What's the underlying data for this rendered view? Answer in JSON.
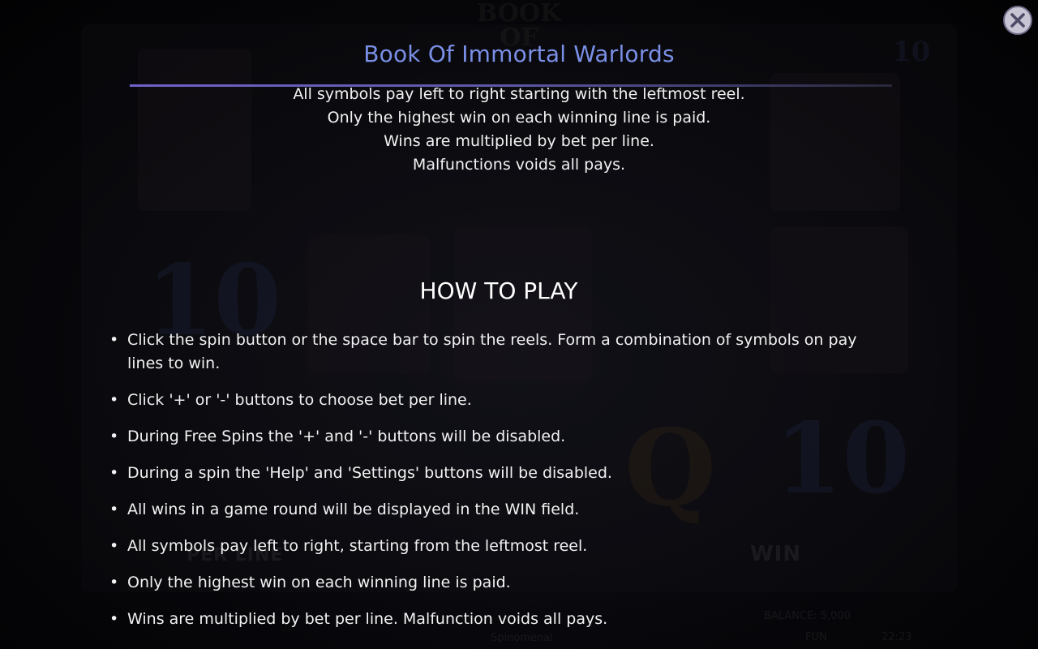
{
  "dialog": {
    "title": "Book Of Immortal Warlords",
    "intro_lines": [
      "All symbols pay left to right starting with the leftmost reel.",
      "Only the highest win on each winning line is paid.",
      "Wins are multiplied by bet per line.",
      "Malfunctions voids all pays."
    ],
    "section_heading": "HOW TO PLAY",
    "bullet_char": "•",
    "rules": [
      "Click the spin button or the space bar to spin the reels. Form a combination of symbols on pay lines to win.",
      "Click '+' or '-' buttons to choose bet per line.",
      "During Free Spins the '+' and '-' buttons will be disabled.",
      "During a spin the 'Help' and 'Settings' buttons will be disabled.",
      "All wins in a game round will be displayed in the WIN field.",
      "All symbols pay left to right, starting from the leftmost reel.",
      "Only the highest win on each winning line is paid.",
      "Wins are multiplied by bet per line. Malfunction voids all pays."
    ],
    "close_icon": "close-icon"
  },
  "background": {
    "logo_text": "BOOK OF",
    "top_number": "10",
    "big_number_left": "10",
    "big_number_right": "10",
    "big_letter": "Q",
    "per_line_label": "PER LINE",
    "win_label": "WIN",
    "balance_text": "BALANCE: 5,000",
    "mode_text": "FUN",
    "clock_text": "22:23",
    "brand_text": "Spinomenal"
  },
  "colors": {
    "title": "#7a8fe6",
    "text": "#f2f2f2",
    "rule": "#6f62c8",
    "close_button": "#c7c4d4"
  }
}
